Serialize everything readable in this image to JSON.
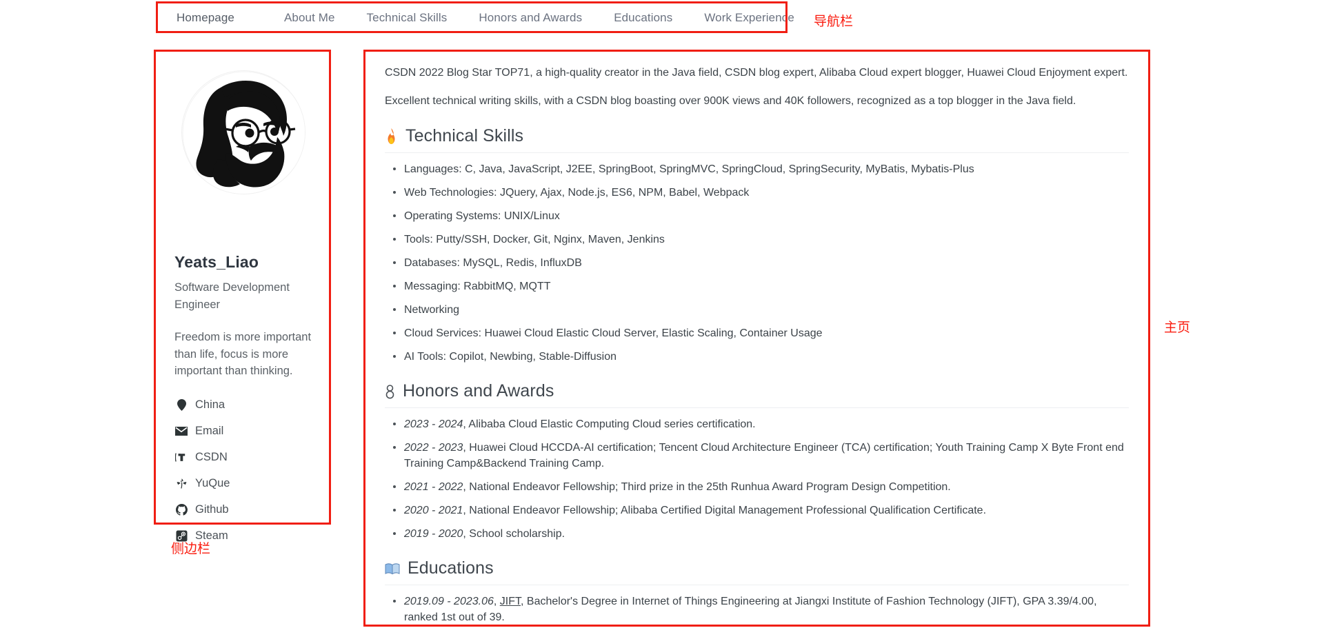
{
  "nav": {
    "items": [
      {
        "label": "Homepage",
        "active": true
      },
      {
        "label": "About Me",
        "active": false
      },
      {
        "label": "Technical Skills",
        "active": false
      },
      {
        "label": "Honors and Awards",
        "active": false
      },
      {
        "label": "Educations",
        "active": false
      },
      {
        "label": "Work Experience",
        "active": false
      }
    ]
  },
  "annotations": {
    "nav_label": "导航栏",
    "sidebar_label": "侧边栏",
    "main_label": "主页",
    "color": "#fa1b0e"
  },
  "sidebar": {
    "avatar_alt": "avatar-illustration",
    "name": "Yeats_Liao",
    "role": "Software Development Engineer",
    "motto": "Freedom is more important than life, focus is more important than thinking.",
    "links": [
      {
        "icon": "location-pin-icon",
        "label": "China"
      },
      {
        "icon": "envelope-icon",
        "label": "Email"
      },
      {
        "icon": "csdn-icon",
        "label": "CSDN"
      },
      {
        "icon": "yuque-icon",
        "label": "YuQue"
      },
      {
        "icon": "github-icon",
        "label": "Github"
      },
      {
        "icon": "steam-icon",
        "label": "Steam"
      }
    ]
  },
  "main": {
    "intro": [
      "CSDN 2022 Blog Star TOP71, a high-quality creator in the Java field, CSDN blog expert, Alibaba Cloud expert blogger, Huawei Cloud Enjoyment expert.",
      "Excellent technical writing skills, with a CSDN blog boasting over 900K views and 40K followers, recognized as a top blogger in the Java field."
    ],
    "sections": [
      {
        "id": "technical-skills",
        "emoji": "fire-emoji",
        "title": "Technical Skills",
        "items": [
          {
            "text": "Languages: C, Java, JavaScript, J2EE, SpringBoot, SpringMVC, SpringCloud, SpringSecurity, MyBatis, Mybatis-Plus"
          },
          {
            "text": "Web Technologies: JQuery, Ajax, Node.js, ES6, NPM, Babel, Webpack"
          },
          {
            "text": "Operating Systems: UNIX/Linux"
          },
          {
            "text": "Tools: Putty/SSH, Docker, Git, Nginx, Maven, Jenkins"
          },
          {
            "text": "Databases: MySQL, Redis, InfluxDB"
          },
          {
            "text": "Messaging: RabbitMQ, MQTT"
          },
          {
            "text": "Networking"
          },
          {
            "text": "Cloud Services: Huawei Cloud Elastic Cloud Server, Elastic Scaling, Container Usage"
          },
          {
            "text": "AI Tools: Copilot, Newbing, Stable-Diffusion"
          }
        ]
      },
      {
        "id": "honors-and-awards",
        "emoji": "medal-emoji",
        "title": "Honors and Awards",
        "items": [
          {
            "year": "2023 - 2024",
            "text": ", Alibaba Cloud Elastic Computing Cloud series certification."
          },
          {
            "year": "2022 - 2023",
            "text": ", Huawei Cloud HCCDA-AI certification; Tencent Cloud Architecture Engineer (TCA) certification; Youth Training Camp X Byte Front end Training Camp&Backend Training Camp."
          },
          {
            "year": "2021 - 2022",
            "text": ", National Endeavor Fellowship; Third prize in the 25th Runhua Award Program Design Competition."
          },
          {
            "year": "2020 - 2021",
            "text": ", National Endeavor Fellowship; Alibaba Certified Digital Management Professional Qualification Certificate."
          },
          {
            "year": "2019 - 2020",
            "text": ", School scholarship."
          }
        ]
      },
      {
        "id": "educations",
        "emoji": "open-book-emoji",
        "title": "Educations",
        "items": [
          {
            "year": "2019.09 - 2023.06",
            "pre": ", ",
            "link": "JIFT",
            "text": ", Bachelor's Degree in Internet of Things Engineering at Jiangxi Institute of Fashion Technology (JIFT), GPA 3.39/4.00, ranked 1st out of 39."
          }
        ]
      }
    ]
  }
}
